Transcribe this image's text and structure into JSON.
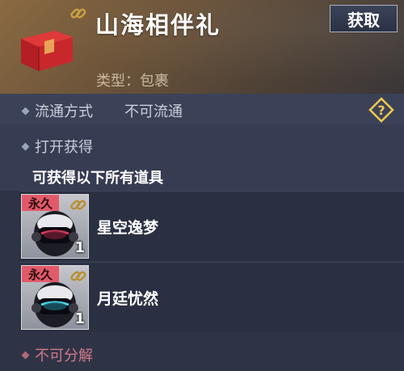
{
  "header": {
    "title": "山海相伴礼",
    "get_button": "获取",
    "type_line": "类型：包裹"
  },
  "flow": {
    "label": "流通方式",
    "value": "不可流通"
  },
  "open": {
    "label": "打开获得",
    "description": "可获得以下所有道具"
  },
  "items": [
    {
      "badge": "永久",
      "name": "星空逸梦",
      "count": "1"
    },
    {
      "badge": "永久",
      "name": "月廷忧然",
      "count": "1"
    }
  ],
  "decompose": {
    "label": "不可分解"
  },
  "colors": {
    "badge": "#e25a6a",
    "decompose_text": "#d2788a",
    "help_icon": "#f2c94c"
  },
  "icons": [
    "gift-box-icon",
    "chain-link-icon",
    "help-diamond-icon",
    "helmet-icon"
  ]
}
